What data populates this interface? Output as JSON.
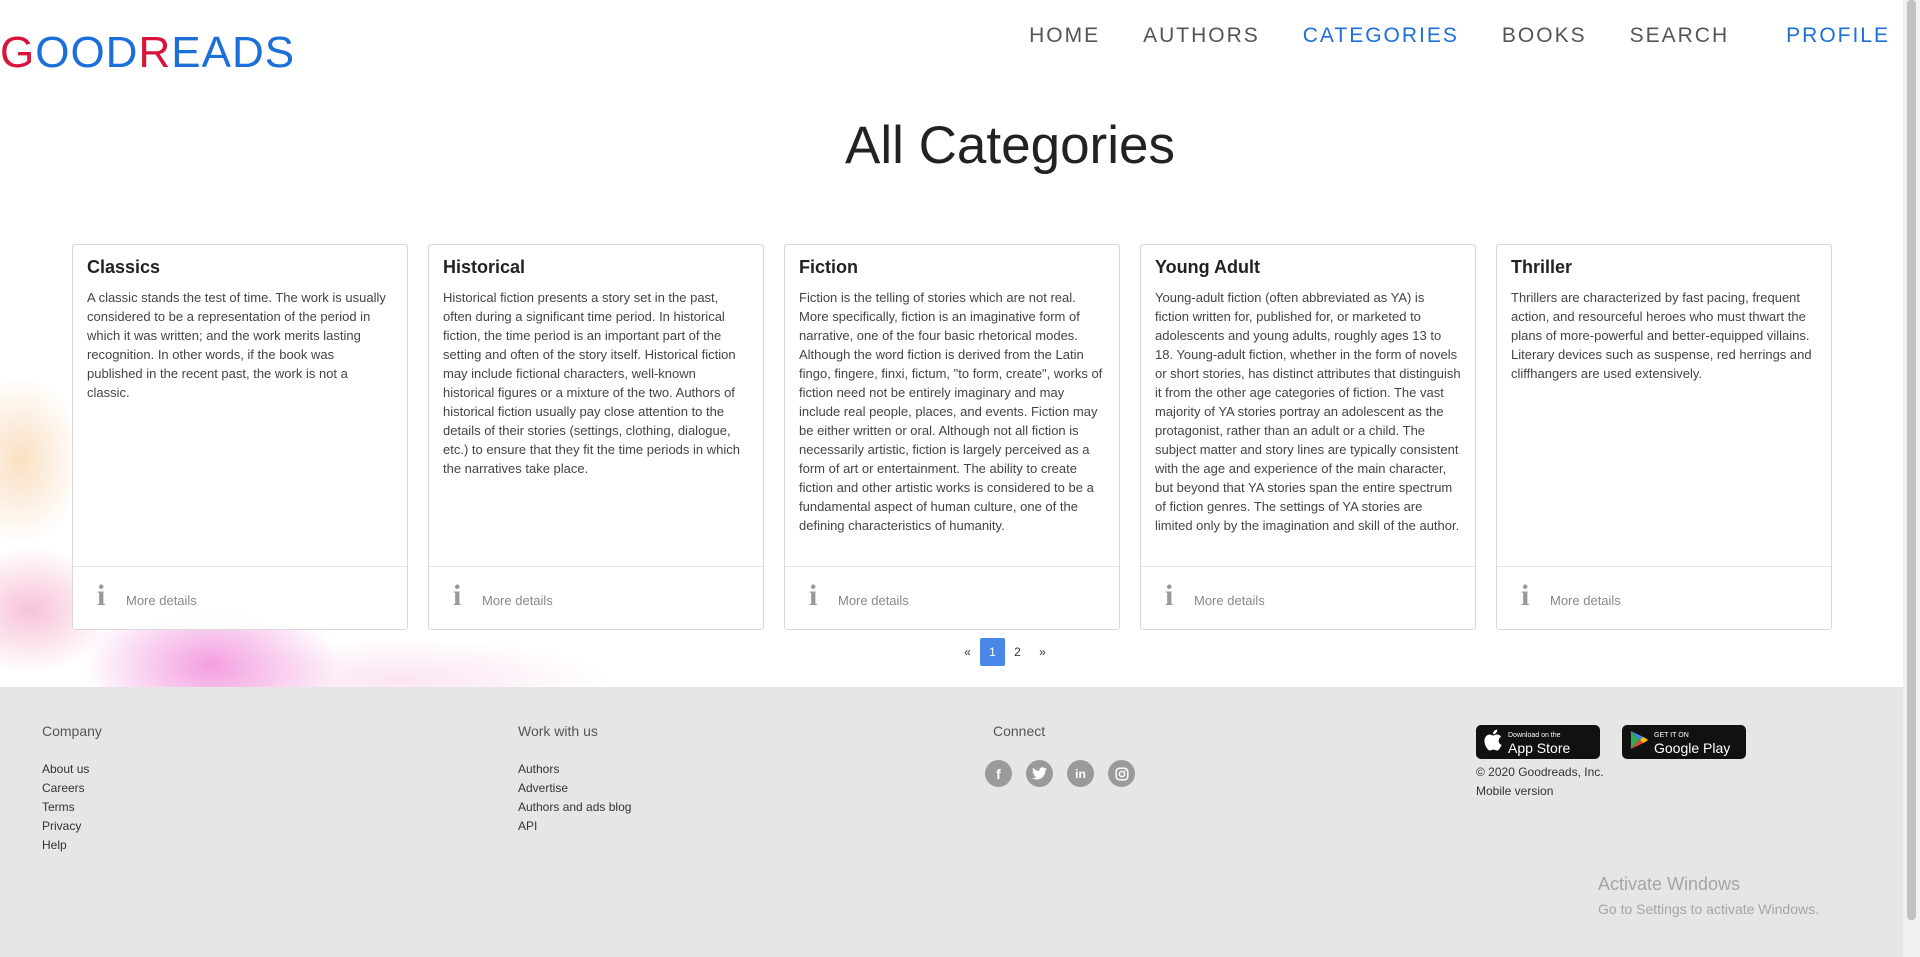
{
  "header": {
    "logo": {
      "g": "G",
      "ood": "OOD",
      "r": "R",
      "eads": "EADS"
    },
    "nav": {
      "home": "HOME",
      "authors": "AUTHORS",
      "categories": "CATEGORIES",
      "books": "BOOKS",
      "search": "SEARCH",
      "profile": "PROFILE"
    },
    "active": "CATEGORIES"
  },
  "page": {
    "title": "All Categories"
  },
  "categories": [
    {
      "title": "Classics",
      "description": "A classic stands the test of time. The work is usually considered to be a representation of the period in which it was written; and the work merits lasting recognition. In other words, if the book was published in the recent past, the work is not a classic.",
      "more": "More details"
    },
    {
      "title": "Historical",
      "description": "Historical fiction presents a story set in the past, often during a significant time period. In historical fiction, the time period is an important part of the setting and often of the story itself. Historical fiction may include fictional characters, well-known historical figures or a mixture of the two. Authors of historical fiction usually pay close attention to the details of their stories (settings, clothing, dialogue, etc.) to ensure that they fit the time periods in which the narratives take place.",
      "more": "More details"
    },
    {
      "title": "Fiction",
      "description": "Fiction is the telling of stories which are not real. More specifically, fiction is an imaginative form of narrative, one of the four basic rhetorical modes. Although the word fiction is derived from the Latin fingo, fingere, finxi, fictum, \"to form, create\", works of fiction need not be entirely imaginary and may include real people, places, and events. Fiction may be either written or oral. Although not all fiction is necessarily artistic, fiction is largely perceived as a form of art or entertainment. The ability to create fiction and other artistic works is considered to be a fundamental aspect of human culture, one of the defining characteristics of humanity.",
      "more": "More details"
    },
    {
      "title": "Young Adult",
      "description": "Young-adult fiction (often abbreviated as YA) is fiction written for, published for, or marketed to adolescents and young adults, roughly ages 13 to 18. Young-adult fiction, whether in the form of novels or short stories, has distinct attributes that distinguish it from the other age categories of fiction. The vast majority of YA stories portray an adolescent as the protagonist, rather than an adult or a child. The subject matter and story lines are typically consistent with the age and experience of the main character, but beyond that YA stories span the entire spectrum of fiction genres. The settings of YA stories are limited only by the imagination and skill of the author.",
      "more": "More details"
    },
    {
      "title": "Thriller",
      "description": "Thrillers are characterized by fast pacing, frequent action, and resourceful heroes who must thwart the plans of more-powerful and better-equipped villains. Literary devices such as suspense, red herrings and cliffhangers are used extensively.",
      "more": "More details"
    }
  ],
  "pagination": {
    "prev": "«",
    "pages": [
      "1",
      "2"
    ],
    "current": "1",
    "next": "»"
  },
  "footer": {
    "company": {
      "heading": "Company",
      "links": [
        "About us",
        "Careers",
        "Terms",
        "Privacy",
        "Help"
      ]
    },
    "work": {
      "heading": "Work with us",
      "links": [
        "Authors",
        "Advertise",
        "Authors and ads blog",
        "API"
      ]
    },
    "connect": {
      "heading": "Connect",
      "icons": [
        "facebook-icon",
        "twitter-icon",
        "linkedin-icon",
        "instagram-icon"
      ]
    },
    "appstore": {
      "small": "Download on the",
      "big": "App Store"
    },
    "googleplay": {
      "small": "GET IT ON",
      "big": "Google Play"
    },
    "copyright": "© 2020 Goodreads, Inc.",
    "mobile": "Mobile version"
  },
  "watermark": {
    "line1": "Activate Windows",
    "line2": "Go to Settings to activate Windows."
  },
  "colors": {
    "brand_blue": "#1b6fd8",
    "brand_red": "#d8143a",
    "pager_active": "#4a86e8",
    "footer_bg": "#e6e6e6"
  }
}
